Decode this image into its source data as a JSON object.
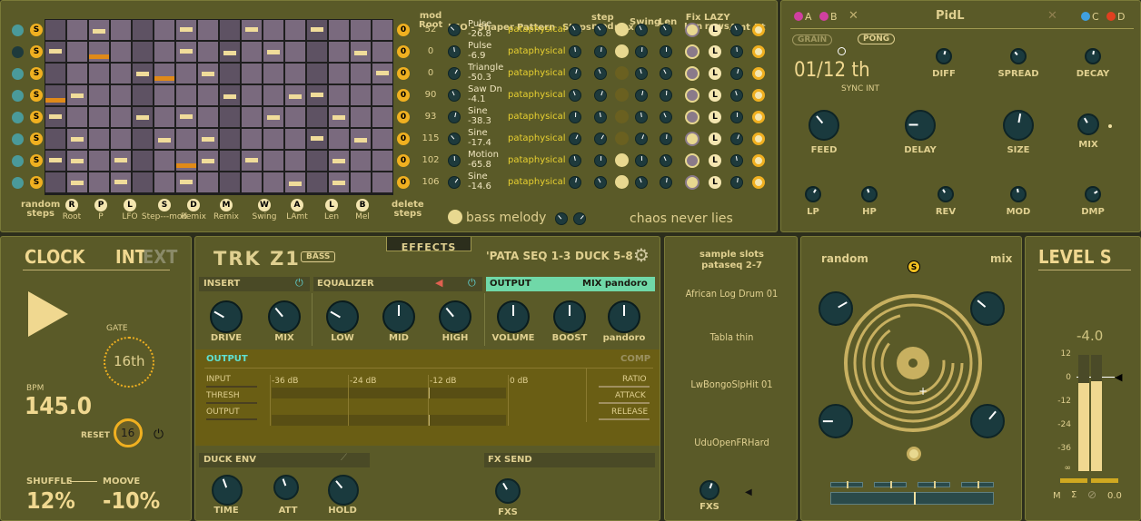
{
  "seq": {
    "col_mod_root": "mod\nRoot",
    "col_lfo": "LFO - Shaper",
    "col_pattern": "Pattern",
    "col_steps": "Steps",
    "col_stepmod": "step\nmod",
    "col_rmx": "rmx",
    "col_swing": "Swing",
    "col_len": "Len",
    "col_fixlen": "Fix\nLen",
    "col_lazy": "LAZY\nrows",
    "col_amt": "Amt",
    "col_rt": "Rt",
    "rows": [
      {
        "mod": "52",
        "shape": "Pulse",
        "val": "-26.8",
        "pattern": "pataphysical"
      },
      {
        "mod": "0",
        "shape": "Pulse",
        "val": "-6.9",
        "pattern": "pataphysical"
      },
      {
        "mod": "0",
        "shape": "Triangle",
        "val": "-50.3",
        "pattern": "pataphysical"
      },
      {
        "mod": "90",
        "shape": "Saw Dn",
        "val": "-4.1",
        "pattern": "pataphysical"
      },
      {
        "mod": "93",
        "shape": "Sine",
        "val": "-38.3",
        "pattern": "pataphysical"
      },
      {
        "mod": "115",
        "shape": "Sine",
        "val": "-17.4",
        "pattern": "pataphysical"
      },
      {
        "mod": "102",
        "shape": "Motion",
        "val": "-65.8",
        "pattern": "pataphysical"
      },
      {
        "mod": "106",
        "shape": "Sine",
        "val": "-14.6",
        "pattern": "pataphysical"
      }
    ],
    "row_badge": "S",
    "row_zero": "0",
    "lazy_badge": "L",
    "bottom_random": "random\nsteps",
    "bottom_delete": "delete\nsteps",
    "bottom": [
      {
        "l": "R",
        "t": "Root"
      },
      {
        "l": "P",
        "t": "P"
      },
      {
        "l": "L",
        "t": "LFO"
      },
      {
        "l": "S",
        "t": "Step---mod"
      },
      {
        "l": "D",
        "t": "Remix"
      },
      {
        "l": "M",
        "t": "Remix2"
      },
      {
        "l": "W",
        "t": "Swing"
      },
      {
        "l": "A",
        "t": "LAmt"
      },
      {
        "l": "L",
        "t": "Len"
      },
      {
        "l": "B",
        "t": "Mel"
      }
    ],
    "bass_melody": "bass melody",
    "chaos": "chaos never lies"
  },
  "pidl": {
    "a": "A",
    "b": "B",
    "c": "C",
    "d": "D",
    "title": "PidL",
    "grain": "GRAIN",
    "pong": "PONG",
    "time": "01/12 th",
    "sync": "SYNC INT",
    "knobs": [
      "DIFF",
      "SPREAD",
      "DECAY",
      "FEED",
      "DELAY",
      "SIZE",
      "MIX",
      "LP",
      "HP",
      "REV",
      "MOD",
      "DMP"
    ]
  },
  "clock": {
    "title": "CLOCK",
    "int": "INT",
    "ext": "EXT",
    "gate": "GATE",
    "gate_val": "16th",
    "bpm_label": "BPM",
    "bpm": "145.0",
    "reset": "RESET",
    "reset_val": "16",
    "shuffle": "SHUFFLE",
    "moove": "MOOVE",
    "shuffle_val": "12%",
    "moove_val": "-10%"
  },
  "fx": {
    "tab": "EFFECTS",
    "logo": "TRK Z1",
    "bass": "BASS",
    "pata": "'PATA SEQ 1-3",
    "duck": "DUCK 5-8",
    "insert": "INSERT",
    "equalizer": "EQUALIZER",
    "output": "OUTPUT",
    "mix_target": "MIX pandoro",
    "knobs": [
      "DRIVE",
      "MIX",
      "LOW",
      "MID",
      "HIGH",
      "VOLUME",
      "BOOST",
      "pandoro"
    ],
    "comp_title": "OUTPUT",
    "comp": "COMP",
    "input": "INPUT",
    "thresh": "THRESH",
    "output_row": "OUTPUT",
    "db": [
      "-36 dB",
      "-24 dB",
      "-12 dB",
      "0 dB"
    ],
    "ratio": "RATIO",
    "attack": "ATTACK",
    "release": "RELEASE",
    "duck_env": "DUCK ENV",
    "fx_send": "FX SEND",
    "duck_knobs": [
      "TIME",
      "ATT",
      "HOLD"
    ],
    "fxs": "FXS"
  },
  "slots": {
    "title": "sample slots\npataseq 2-7",
    "items": [
      "African Log Drum 01",
      "Tabla thin",
      "LwBongoSlpHit 01",
      "UduOpenFRHard"
    ],
    "fxs": "FXS"
  },
  "random": {
    "random": "random",
    "mix": "mix",
    "s": "S"
  },
  "level": {
    "title": "LEVEL S",
    "value": "-4.0",
    "scale": [
      "12",
      "0",
      "-12",
      "-24",
      "-36",
      "∞"
    ],
    "m": "M",
    "sum": "Σ",
    "val": "0.0",
    "meter_l": 0.76,
    "meter_r": 0.77
  }
}
